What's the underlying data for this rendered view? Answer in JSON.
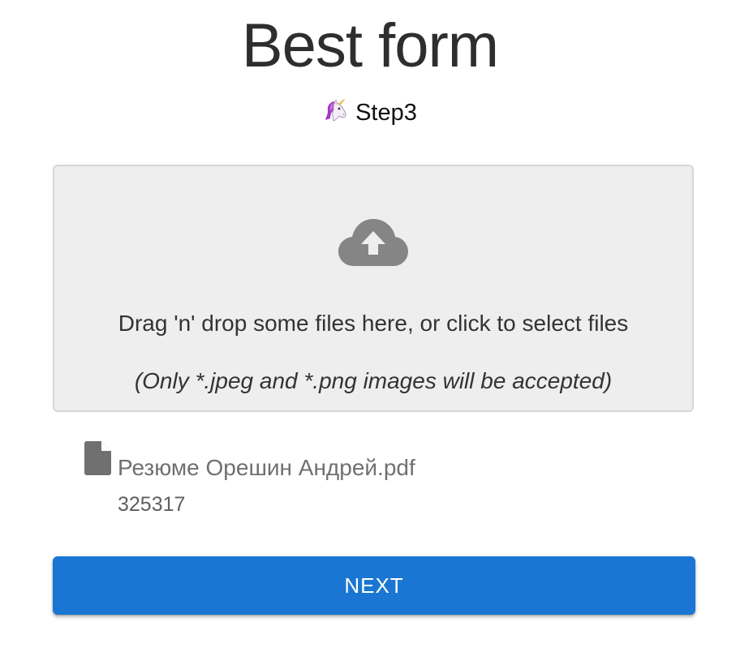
{
  "header": {
    "title": "Best form",
    "step_label": "Step3",
    "step_icon": "unicorn-icon"
  },
  "dropzone": {
    "icon": "cloud-upload-icon",
    "instruction": "Drag 'n' drop some files here, or click to select files",
    "hint": "(Only *.jpeg and *.png images will be accepted)",
    "background_color": "#eeeeee",
    "border_color": "#d6d6d6"
  },
  "files": [
    {
      "icon": "file-icon",
      "name": "Резюме Орешин Андрей.pdf",
      "size": "325317"
    }
  ],
  "actions": {
    "next_label": "NEXT",
    "next_color": "#1a76d2"
  }
}
